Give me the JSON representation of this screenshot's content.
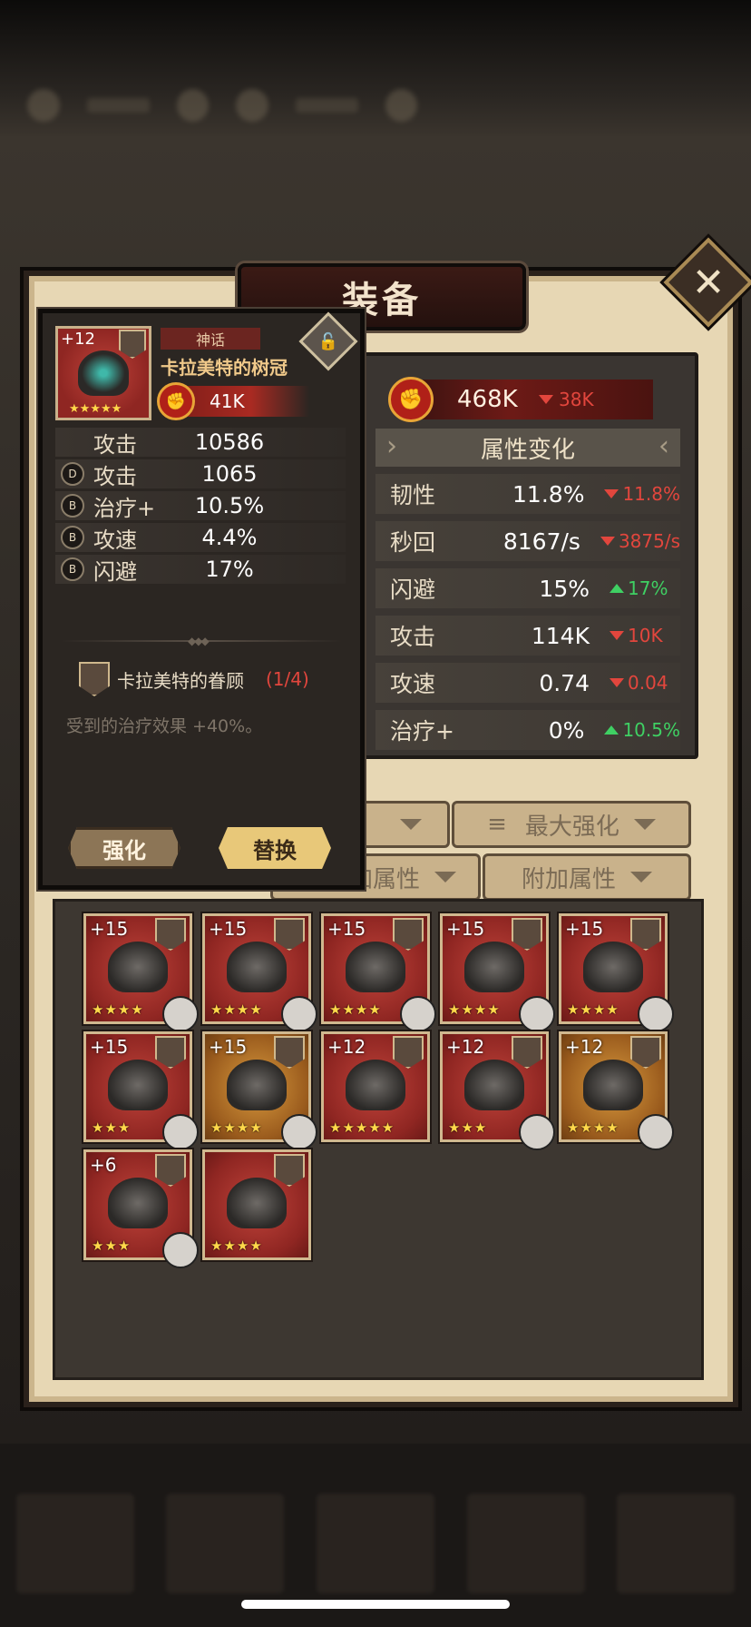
{
  "panel": {
    "title": "装备",
    "close_label": "✕"
  },
  "detail": {
    "level": "+12",
    "rarity": "神话",
    "name": "卡拉美特的树冠",
    "power": "41K",
    "stars": "★★★★★",
    "lock_glyph": "🔓",
    "stats": [
      {
        "grade": "",
        "name": "攻击",
        "value": "10586"
      },
      {
        "grade": "D",
        "name": "攻击",
        "value": "1065"
      },
      {
        "grade": "B",
        "name": "治疗+",
        "value": "10.5%"
      },
      {
        "grade": "B",
        "name": "攻速",
        "value": "4.4%"
      },
      {
        "grade": "B",
        "name": "闪避",
        "value": "17%"
      }
    ],
    "set_name": "卡拉美特的眷顾",
    "set_count": "(1/4)",
    "set_desc": "受到的治疗效果 +40%。",
    "upgrade_label": "强化",
    "replace_label": "替换"
  },
  "attributes": {
    "power": "468K",
    "power_diff": "38K",
    "header": "属性变化",
    "rows": [
      {
        "name": "韧性",
        "value": "11.8%",
        "diff": "11.8%",
        "dir": "down"
      },
      {
        "name": "秒回",
        "value": "8167/s",
        "diff": "3875/s",
        "dir": "down"
      },
      {
        "name": "闪避",
        "value": "15%",
        "diff": "17%",
        "dir": "up"
      },
      {
        "name": "攻击",
        "value": "114K",
        "diff": "10K",
        "dir": "down"
      },
      {
        "name": "攻速",
        "value": "0.74",
        "diff": "0.04",
        "dir": "down"
      },
      {
        "name": "治疗+",
        "value": "0%",
        "diff": "10.5%",
        "dir": "up"
      }
    ]
  },
  "filters": {
    "sort": "最大强化",
    "attr": "加属性",
    "extra": "附加属性"
  },
  "items": [
    {
      "level": "+15",
      "stars": "★★★★",
      "gold": false,
      "hero": true
    },
    {
      "level": "+15",
      "stars": "★★★★",
      "gold": false,
      "hero": true
    },
    {
      "level": "+15",
      "stars": "★★★★",
      "gold": false,
      "hero": true
    },
    {
      "level": "+15",
      "stars": "★★★★",
      "gold": false,
      "hero": true
    },
    {
      "level": "+15",
      "stars": "★★★★",
      "gold": false,
      "hero": true
    },
    {
      "level": "+15",
      "stars": "★★★",
      "gold": false,
      "hero": true
    },
    {
      "level": "+15",
      "stars": "★★★★",
      "gold": true,
      "hero": true
    },
    {
      "level": "+12",
      "stars": "★★★★★",
      "gold": false,
      "hero": false
    },
    {
      "level": "+12",
      "stars": "★★★",
      "gold": false,
      "hero": true
    },
    {
      "level": "+12",
      "stars": "★★★★",
      "gold": true,
      "hero": true
    },
    {
      "level": "+6",
      "stars": "★★★",
      "gold": false,
      "hero": true
    },
    {
      "level": "",
      "stars": "★★★★",
      "gold": false,
      "hero": false
    }
  ]
}
